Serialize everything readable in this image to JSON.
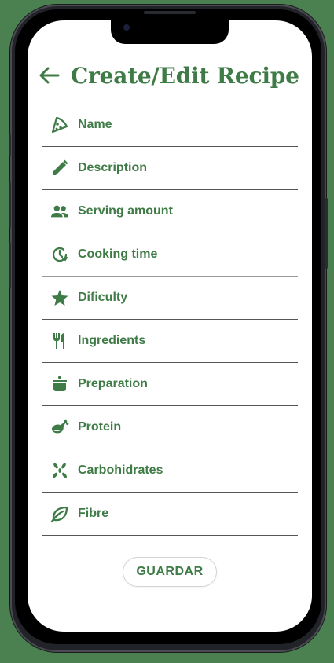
{
  "header": {
    "title": "Create/Edit Recipe",
    "back_icon": "arrow-left-icon"
  },
  "fields": [
    {
      "id": "name",
      "label": "Name",
      "icon": "pizza-slice-icon"
    },
    {
      "id": "description",
      "label": "Description",
      "icon": "pencil-icon"
    },
    {
      "id": "serving",
      "label": "Serving amount",
      "icon": "people-icon"
    },
    {
      "id": "cooking-time",
      "label": "Cooking time",
      "icon": "clock-history-icon"
    },
    {
      "id": "difficulty",
      "label": "Dificulty",
      "icon": "star-icon"
    },
    {
      "id": "ingredients",
      "label": "Ingredients",
      "icon": "fork-knife-icon"
    },
    {
      "id": "preparation",
      "label": "Preparation",
      "icon": "cooking-pot-icon"
    },
    {
      "id": "protein",
      "label": "Protein",
      "icon": "chicken-leg-icon"
    },
    {
      "id": "carbohydrates",
      "label": "Carbohidrates",
      "icon": "grain-icon"
    },
    {
      "id": "fibre",
      "label": "Fibre",
      "icon": "leaf-icon"
    }
  ],
  "actions": {
    "save_label": "GUARDAR"
  },
  "colors": {
    "accent": "#3e7b46",
    "background": "#4b8150"
  }
}
